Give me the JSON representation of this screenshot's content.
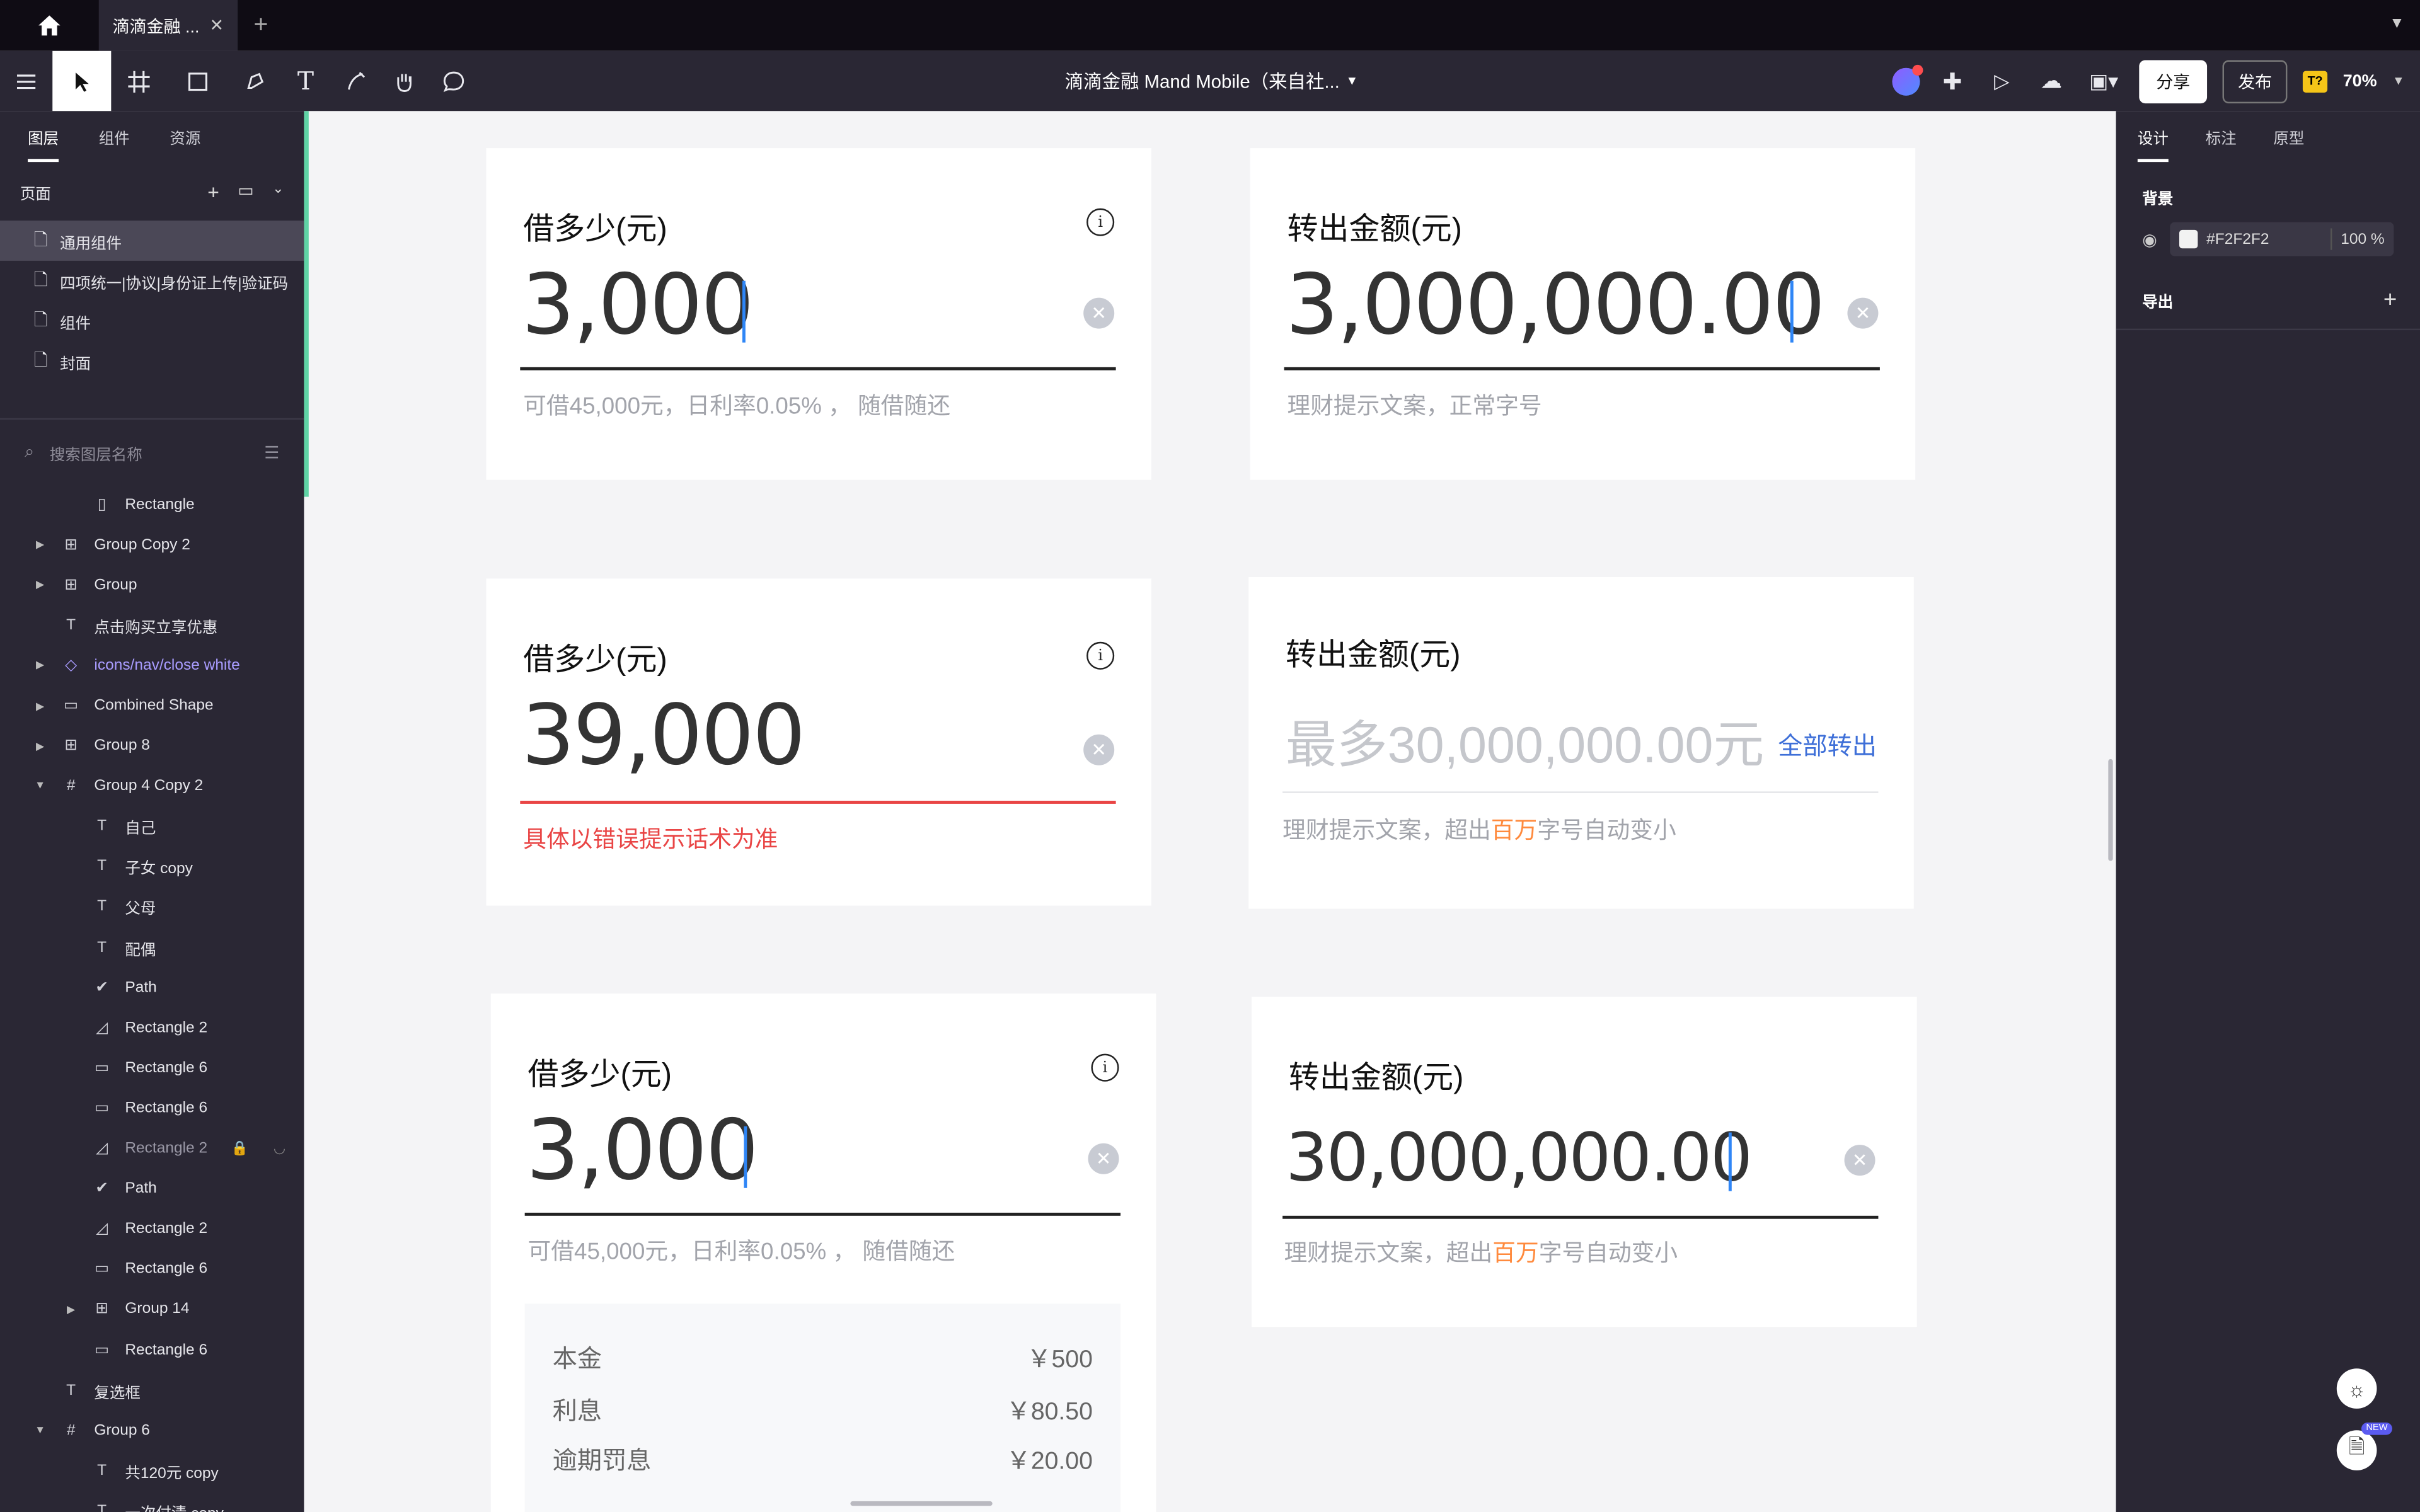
{
  "titlebar": {
    "tab_title": "滴滴金融 ...",
    "close": "✕",
    "new_tab": "+"
  },
  "toolbar": {
    "doc_title": "滴滴金融 Mand Mobile（来自社...",
    "share": "分享",
    "publish": "发布",
    "zoom": "70%",
    "badge": "T?"
  },
  "left": {
    "tabs": [
      "图层",
      "组件",
      "资源"
    ],
    "pages_label": "页面",
    "pages": [
      "通用组件",
      "四项统一|协议|身份证上传|验证码",
      "组件",
      "封面"
    ],
    "search_placeholder": "搜索图层名称",
    "layers": [
      {
        "name": "Rectangle"
      },
      {
        "name": "Group Copy 2"
      },
      {
        "name": "Group"
      },
      {
        "name": "点击购买立享优惠"
      },
      {
        "name": "icons/nav/close white"
      },
      {
        "name": "Combined Shape"
      },
      {
        "name": "Group 8"
      },
      {
        "name": "Group 4 Copy 2"
      },
      {
        "name": "自己"
      },
      {
        "name": "子女 copy"
      },
      {
        "name": "父母"
      },
      {
        "name": "配偶"
      },
      {
        "name": "Path"
      },
      {
        "name": "Rectangle 2"
      },
      {
        "name": "Rectangle 6"
      },
      {
        "name": "Rectangle 6"
      },
      {
        "name": "Rectangle 2"
      },
      {
        "name": "Path"
      },
      {
        "name": "Rectangle 2"
      },
      {
        "name": "Rectangle 6"
      },
      {
        "name": "Group 14"
      },
      {
        "name": "Rectangle 6"
      },
      {
        "name": "复选框"
      },
      {
        "name": "Group 6"
      },
      {
        "name": "共120元 copy"
      },
      {
        "name": "一次付清 copy"
      }
    ]
  },
  "canvas": {
    "c1": {
      "label": "借多少(元)",
      "amount": "3,000",
      "hint": "可借45,000元，日利率0.05% ， 随借随还"
    },
    "c2": {
      "label": "转出金额(元)",
      "amount": "3,000,000.00",
      "hint": "理财提示文案，正常字号"
    },
    "c3": {
      "label": "借多少(元)",
      "amount": "39,000",
      "error": "具体以错误提示话术为准"
    },
    "c4": {
      "label": "转出金额(元)",
      "placeholder": "最多30,000,000.00元",
      "all_out": "全部转出",
      "hint_a": "理财提示文案，超出",
      "hint_hl": "百万",
      "hint_b": "字号自动变小"
    },
    "c5": {
      "label": "借多少(元)",
      "amount": "3,000",
      "hint": "可借45,000元，日利率0.05% ， 随借随还",
      "details": [
        {
          "k": "本金",
          "v": "￥500"
        },
        {
          "k": "利息",
          "v": "￥80.50"
        },
        {
          "k": "逾期罚息",
          "v": "￥20.00"
        }
      ]
    },
    "c6": {
      "label": "转出金额(元)",
      "amount": "30,000,000.00",
      "hint_a": "理财提示文案，超出",
      "hint_hl": "百万",
      "hint_b": "字号自动变小"
    }
  },
  "right": {
    "tabs": [
      "设计",
      "标注",
      "原型"
    ],
    "bg_label": "背景",
    "bg_color": "#F2F2F2",
    "bg_opacity": "100 %",
    "export_label": "导出",
    "new_badge": "NEW"
  }
}
